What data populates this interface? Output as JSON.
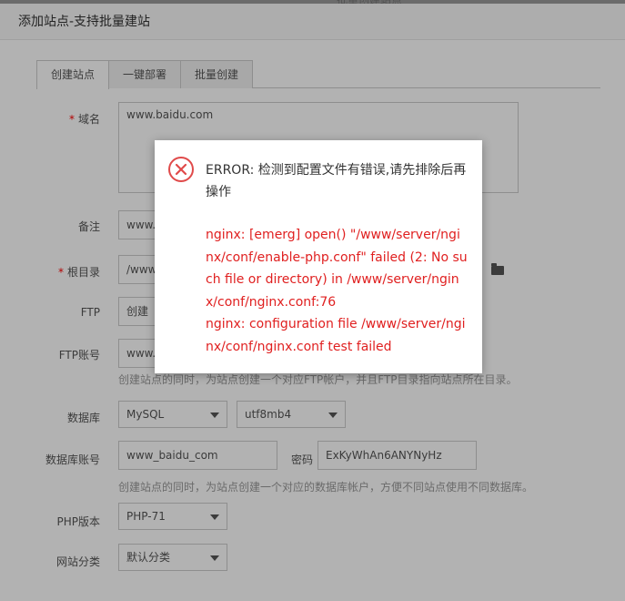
{
  "background": {
    "top_text": "批量创建站点"
  },
  "dialog": {
    "title": "添加站点-支持批量建站"
  },
  "tabs": [
    {
      "label": "创建站点",
      "active": true
    },
    {
      "label": "一键部署",
      "active": false
    },
    {
      "label": "批量创建",
      "active": false
    }
  ],
  "form": {
    "domain": {
      "label": "域名",
      "value": "www.baidu.com"
    },
    "remark": {
      "label": "备注",
      "value": "www.b"
    },
    "root": {
      "label": "根目录",
      "value": "/www"
    },
    "ftp": {
      "label": "FTP",
      "value": "创建"
    },
    "ftp_account": {
      "label": "FTP账号",
      "value": "www.",
      "hint": "创建站点的同时，为站点创建一个对应FTP帐户，并且FTP目录指向站点所在目录。"
    },
    "database": {
      "label": "数据库",
      "type": "MySQL",
      "charset": "utf8mb4"
    },
    "db_account": {
      "label": "数据库账号",
      "value": "www_baidu_com",
      "password_label": "密码",
      "password": "ExKyWhAn6ANYNyHz",
      "hint": "创建站点的同时，为站点创建一个对应的数据库帐户，方便不同站点使用不同数据库。"
    },
    "php": {
      "label": "PHP版本",
      "value": "PHP-71"
    },
    "category": {
      "label": "网站分类",
      "value": "默认分类"
    }
  },
  "error": {
    "head": "ERROR: 检测到配置文件有错误,请先排除后再操作",
    "line1": "nginx: [emerg] open() \"/www/server/nginx/conf/enable-php.conf\" failed (2: No such file or directory) in /www/server/nginx/conf/nginx.conf:76",
    "line2": "nginx: configuration file /www/server/nginx/conf/nginx.conf test failed"
  },
  "colors": {
    "error_red": "#e02020",
    "required_red": "#ff0000"
  },
  "icons": {
    "error": "x-circle-icon",
    "folder": "folder-icon",
    "caret": "chevron-down-icon"
  }
}
